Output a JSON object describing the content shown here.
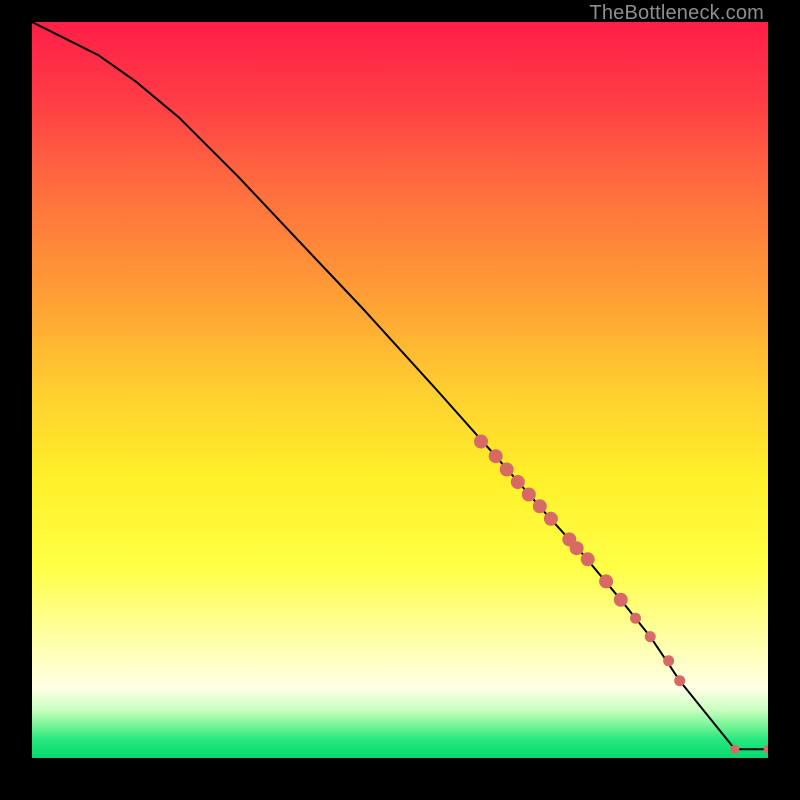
{
  "watermark": "TheBottleneck.com",
  "gradient": {
    "stops": [
      {
        "offset": 0.0,
        "color": "#ff1f47"
      },
      {
        "offset": 0.1,
        "color": "#ff3a46"
      },
      {
        "offset": 0.22,
        "color": "#ff6b3f"
      },
      {
        "offset": 0.36,
        "color": "#ff9a36"
      },
      {
        "offset": 0.5,
        "color": "#ffce2f"
      },
      {
        "offset": 0.62,
        "color": "#fff02a"
      },
      {
        "offset": 0.74,
        "color": "#ffff45"
      },
      {
        "offset": 0.84,
        "color": "#ffffa8"
      },
      {
        "offset": 0.905,
        "color": "#ffffe6"
      },
      {
        "offset": 0.935,
        "color": "#c8ffc0"
      },
      {
        "offset": 0.955,
        "color": "#7af598"
      },
      {
        "offset": 0.975,
        "color": "#28e87e"
      },
      {
        "offset": 1.0,
        "color": "#05d96f"
      }
    ]
  },
  "chart_data": {
    "type": "line",
    "title": "",
    "xlabel": "",
    "ylabel": "",
    "xlim": [
      0,
      100
    ],
    "ylim": [
      0,
      100
    ],
    "curve_x": [
      0,
      4,
      9,
      14,
      20,
      28,
      36,
      45,
      55,
      63,
      70,
      75,
      80,
      84,
      86,
      88,
      95.5,
      100
    ],
    "curve_y": [
      100,
      98,
      95.5,
      92,
      87,
      79,
      70.5,
      61,
      50,
      41,
      33,
      27.5,
      21.5,
      16.5,
      13.5,
      10.5,
      1.2,
      1.2
    ],
    "markers_x": [
      61,
      63,
      64.5,
      66,
      67.5,
      69,
      70.5,
      73,
      74,
      75.5,
      78,
      80,
      82,
      84,
      86.5,
      88,
      95.5,
      100
    ],
    "markers_y": [
      43,
      41,
      39.2,
      37.5,
      35.8,
      34.2,
      32.5,
      29.7,
      28.5,
      27,
      24,
      21.5,
      19,
      16.5,
      13.2,
      10.5,
      1.2,
      1.2
    ],
    "marker_color": "#d86a66",
    "marker_radius_major": 7,
    "marker_radius_minor": 4.5
  }
}
